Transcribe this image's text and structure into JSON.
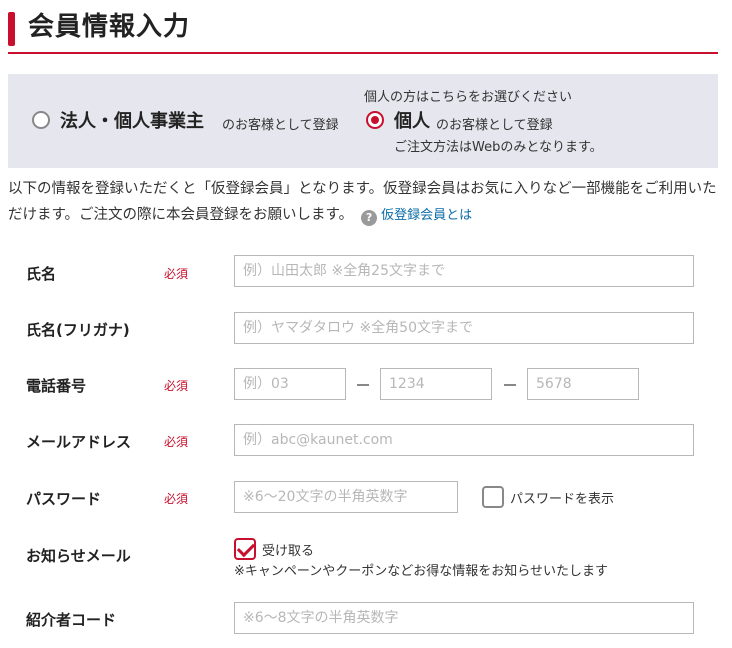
{
  "page_title": "会員情報入力",
  "member_type": {
    "corporate_label": "法人・個人事業主",
    "corporate_suffix": "のお客様として登録",
    "personal_hint": "個人の方はこちらをお選びください",
    "personal_label": "個人",
    "personal_suffix": "のお客様として登録",
    "personal_note": "ご注文方法はWebのみとなります。",
    "selected": "personal"
  },
  "intro": {
    "text": "以下の情報を登録いただくと「仮登録会員」となります。仮登録会員はお気に入りなど一部機能をご利用いただけます。ご注文の際に本会員登録をお願いします。",
    "help_icon": "?",
    "link_text": "仮登録会員とは"
  },
  "required_label": "必須",
  "fields": {
    "name": {
      "label": "氏名",
      "placeholder": "例）山田太郎 ※全角25文字まで"
    },
    "kana": {
      "label": "氏名(フリガナ)",
      "placeholder": "例）ヤマダタロウ ※全角50文字まで"
    },
    "phone": {
      "label": "電話番号",
      "placeholder1": "例）03",
      "placeholder2": "1234",
      "placeholder3": "5678"
    },
    "email": {
      "label": "メールアドレス",
      "placeholder": "例）abc@kaunet.com"
    },
    "password": {
      "label": "パスワード",
      "placeholder": "※6～20文字の半角英数字",
      "show_label": "パスワードを表示"
    },
    "newsletter": {
      "label": "お知らせメール",
      "checkbox_label": "受け取る",
      "note": "※キャンペーンやクーポンなどお得な情報をお知らせいたします",
      "checked": true
    },
    "referrer": {
      "label": "紹介者コード",
      "placeholder": "※6～8文字の半角英数字"
    }
  },
  "colors": {
    "accent": "#c8102e",
    "panel_bg": "#e6e6ee",
    "link": "#0b6ca8"
  }
}
